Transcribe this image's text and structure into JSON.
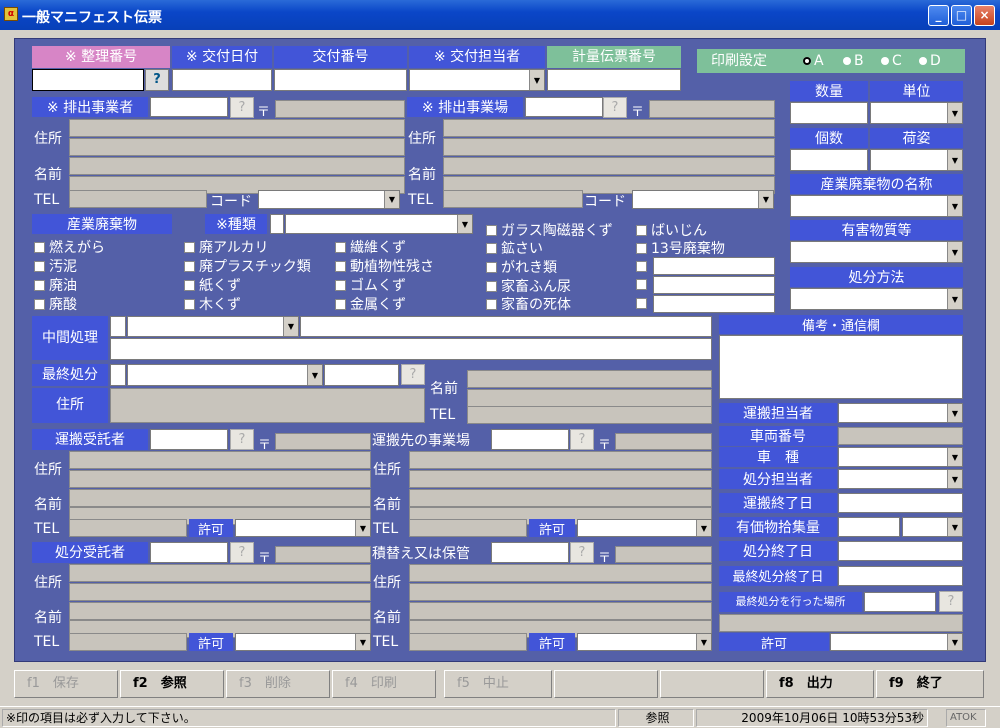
{
  "window": {
    "title": "一般マニフェスト伝票",
    "icon_text": "α"
  },
  "header": {
    "seiri_bango": "※ 整理番号",
    "kofu_hizuke": "※ 交付日付",
    "kofu_bango": "交付番号",
    "kofu_tanto": "※ 交付担当者",
    "keiryo_denpyo": "計量伝票番号",
    "help_mark": "?"
  },
  "print_settings": {
    "label": "印刷設定",
    "options": [
      "A",
      "B",
      "C",
      "D"
    ],
    "selected": "A"
  },
  "common": {
    "zip": "〒",
    "address": "住所",
    "name": "名前",
    "tel": "TEL",
    "code": "コード",
    "permit": "許可",
    "q": "?",
    "arrow": "▼"
  },
  "haishutsu": {
    "jigyosha": "※ 排出事業者",
    "jigyojo": "※ 排出事業場"
  },
  "right_panel": {
    "suryo": "数量",
    "tani": "単位",
    "kosu": "個数",
    "nisugata": "荷姿",
    "meisho": "産業廃棄物の名称",
    "yugai": "有害物質等",
    "shobun_hoho": "処分方法"
  },
  "waste": {
    "title": "産業廃棄物",
    "type_label": "※種類",
    "col1": [
      "燃えがら",
      "汚泥",
      "廃油",
      "廃酸"
    ],
    "col2": [
      "廃アルカリ",
      "廃プラスチック類",
      "紙くず",
      "木くず"
    ],
    "col3": [
      "繊維くず",
      "動植物性残さ",
      "ゴムくず",
      "金属くず"
    ],
    "col4": [
      "ガラス陶磁器くず",
      "鉱さい",
      "がれき類",
      "家畜ふん尿",
      "家畜の死体"
    ],
    "col5": [
      "ばいじん",
      "13号廃棄物"
    ]
  },
  "chukan": {
    "label": "中間処理"
  },
  "saishu": {
    "label": "最終処分"
  },
  "biko": {
    "label": "備考・通信欄"
  },
  "transport": {
    "unpan_jutaku": "運搬受託者",
    "unpan_saki": "運搬先の事業場",
    "shobun_jutaku": "処分受託者",
    "tsumikae": "積替え又は保管"
  },
  "right_lower": {
    "unpan_tanto": "運搬担当者",
    "sharyo": "車両番号",
    "shashu": "車　種",
    "shobun_tanto": "処分担当者",
    "unpan_shuryo": "運搬終了日",
    "yuka_shuryo": "有価物拾集量",
    "shobun_shuryo": "処分終了日",
    "saishu_shuryo": "最終処分終了日",
    "saishu_basho": "最終処分を行った場所",
    "kyoka": "許可"
  },
  "fkeys": [
    {
      "label": "f1　保存",
      "enabled": false
    },
    {
      "label": "f2　参照",
      "enabled": true
    },
    {
      "label": "f3　削除",
      "enabled": false
    },
    {
      "label": "f4　印刷",
      "enabled": false
    },
    {
      "label": "f5　中止",
      "enabled": false
    },
    {
      "label": "",
      "enabled": false
    },
    {
      "label": "",
      "enabled": false
    },
    {
      "label": "f8　出力",
      "enabled": true
    },
    {
      "label": "f9　終了",
      "enabled": true
    }
  ],
  "status": {
    "message": "※印の項目は必ず入力して下さい。",
    "mode": "参照",
    "datetime": "2009年10月06日 10時53分53秒",
    "ime": "ATOK"
  }
}
